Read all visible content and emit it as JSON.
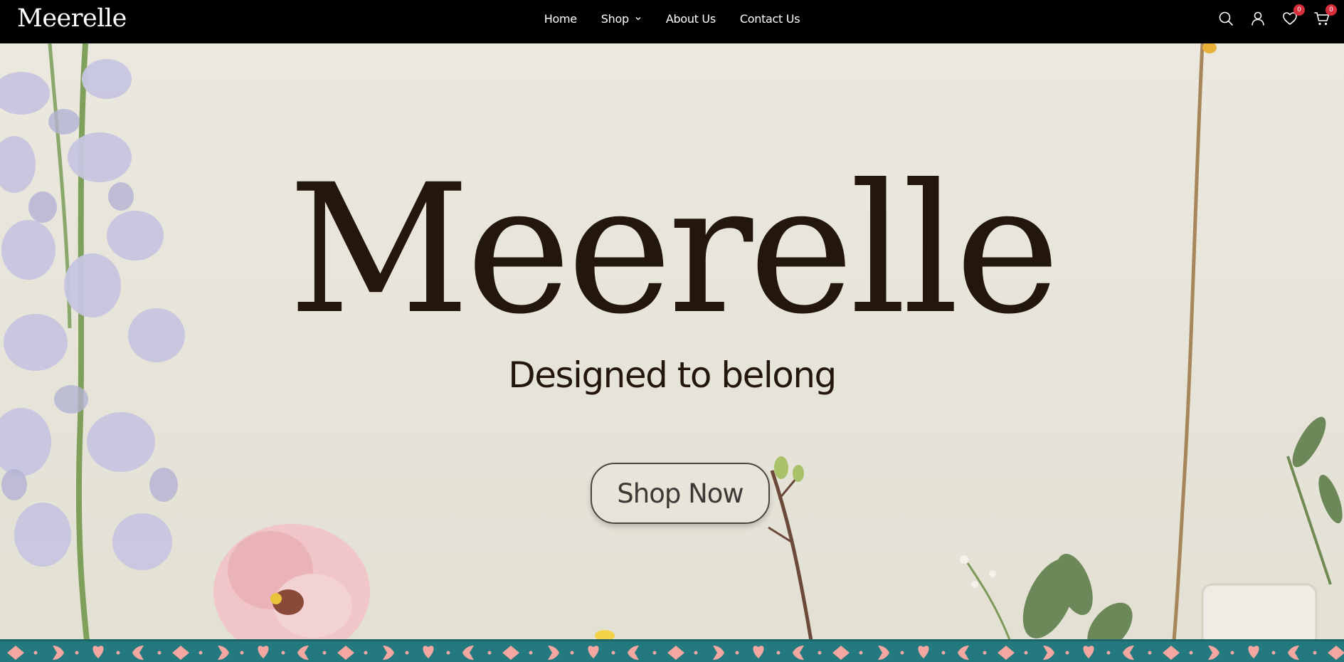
{
  "header": {
    "logo_text": "Meerelle",
    "nav": [
      {
        "label": "Home"
      },
      {
        "label": "Shop",
        "has_dropdown": true
      },
      {
        "label": "About Us"
      },
      {
        "label": "Contact Us"
      }
    ],
    "icons": {
      "search": "search-icon",
      "account": "user-icon",
      "wishlist": "heart-icon",
      "cart": "cart-icon"
    },
    "wishlist_count": "0",
    "cart_count": "0"
  },
  "hero": {
    "title": "Meerelle",
    "subtitle": "Designed to belong",
    "cta_label": "Shop Now"
  },
  "colors": {
    "header_bg": "#000000",
    "title": "#23160d",
    "badge": "#d62e3a",
    "band_bg": "#23797d",
    "band_pattern": "#f4a6a0"
  }
}
